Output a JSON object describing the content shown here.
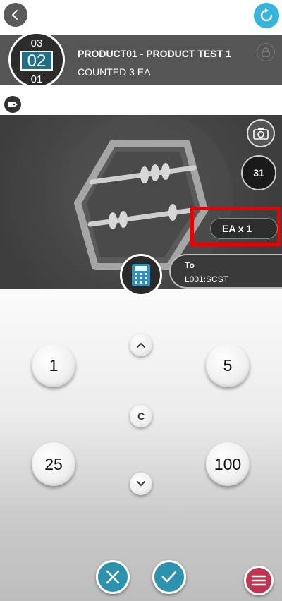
{
  "header": {
    "counter_prev": "03",
    "counter_current": "02",
    "counter_next": "01",
    "product_name": "PRODUCT01 - PRODUCT TEST 1",
    "counted": "COUNTED 3 EA"
  },
  "image_panel": {
    "days_badge": "31",
    "unit": "EA x 1"
  },
  "location": {
    "label": "To",
    "value": "L001:SCST"
  },
  "keypad": {
    "buttons": [
      "1",
      "5",
      "25",
      "100"
    ],
    "clear": "C"
  },
  "icons": {
    "back": "chevron-left-icon",
    "refresh": "refresh-icon",
    "lock": "lock-icon",
    "tag": "tag-icon",
    "camera": "camera-icon",
    "calculator": "calculator-icon",
    "up": "chevron-up-icon",
    "down": "chevron-down-icon",
    "cancel": "close-icon",
    "confirm": "check-icon",
    "menu": "hamburger-menu-icon"
  },
  "colors": {
    "accent": "#35b5dd",
    "action": "#2d92ad",
    "menu": "#c0344f",
    "highlight": "#ee0000"
  }
}
